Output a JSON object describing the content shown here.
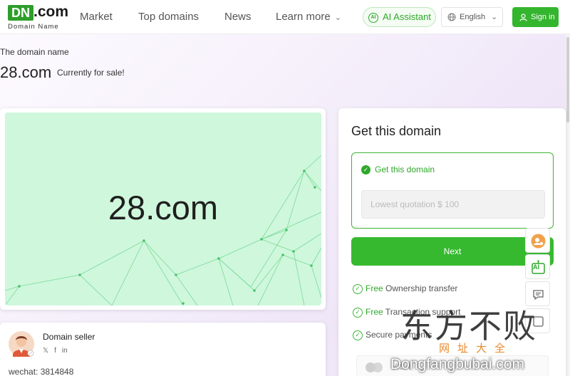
{
  "header": {
    "logo_mark": "DN",
    "logo_suffix": ".com",
    "logo_subtitle": "Domain Name",
    "nav": [
      "Market",
      "Top domains",
      "News",
      "Learn more"
    ],
    "ai_badge": "AI",
    "ai_button": "AI Assistant",
    "language": "English",
    "sign_in": "Sign in"
  },
  "hero": {
    "label": "The domain name",
    "domain": "28.com",
    "status": "Currently for sale!"
  },
  "preview": {
    "domain": "28.com"
  },
  "seller": {
    "title": "Domain seller",
    "social": [
      "𝕏",
      "f",
      "in"
    ],
    "wechat": "wechat: 3814848"
  },
  "purchase": {
    "title": "Get this domain",
    "option_label": "Get this domain",
    "quote_placeholder": "Lowest quotation $ 100",
    "next_button": "Next",
    "features": [
      {
        "free": "Free",
        "text": " Ownership transfer"
      },
      {
        "free": "Free",
        "text": " Transaction support"
      },
      {
        "free": "",
        "text": "Secure payments"
      }
    ],
    "payment_logos": [
      "VISA"
    ]
  },
  "side_tools": {
    "ai_label": "AI"
  },
  "watermark": {
    "main": "东方不败",
    "sub": "网址大全",
    "url": "Dongfangbubai.com"
  },
  "colors": {
    "brand_green": "#34b52e",
    "preview_bg": "#cff7dc"
  }
}
